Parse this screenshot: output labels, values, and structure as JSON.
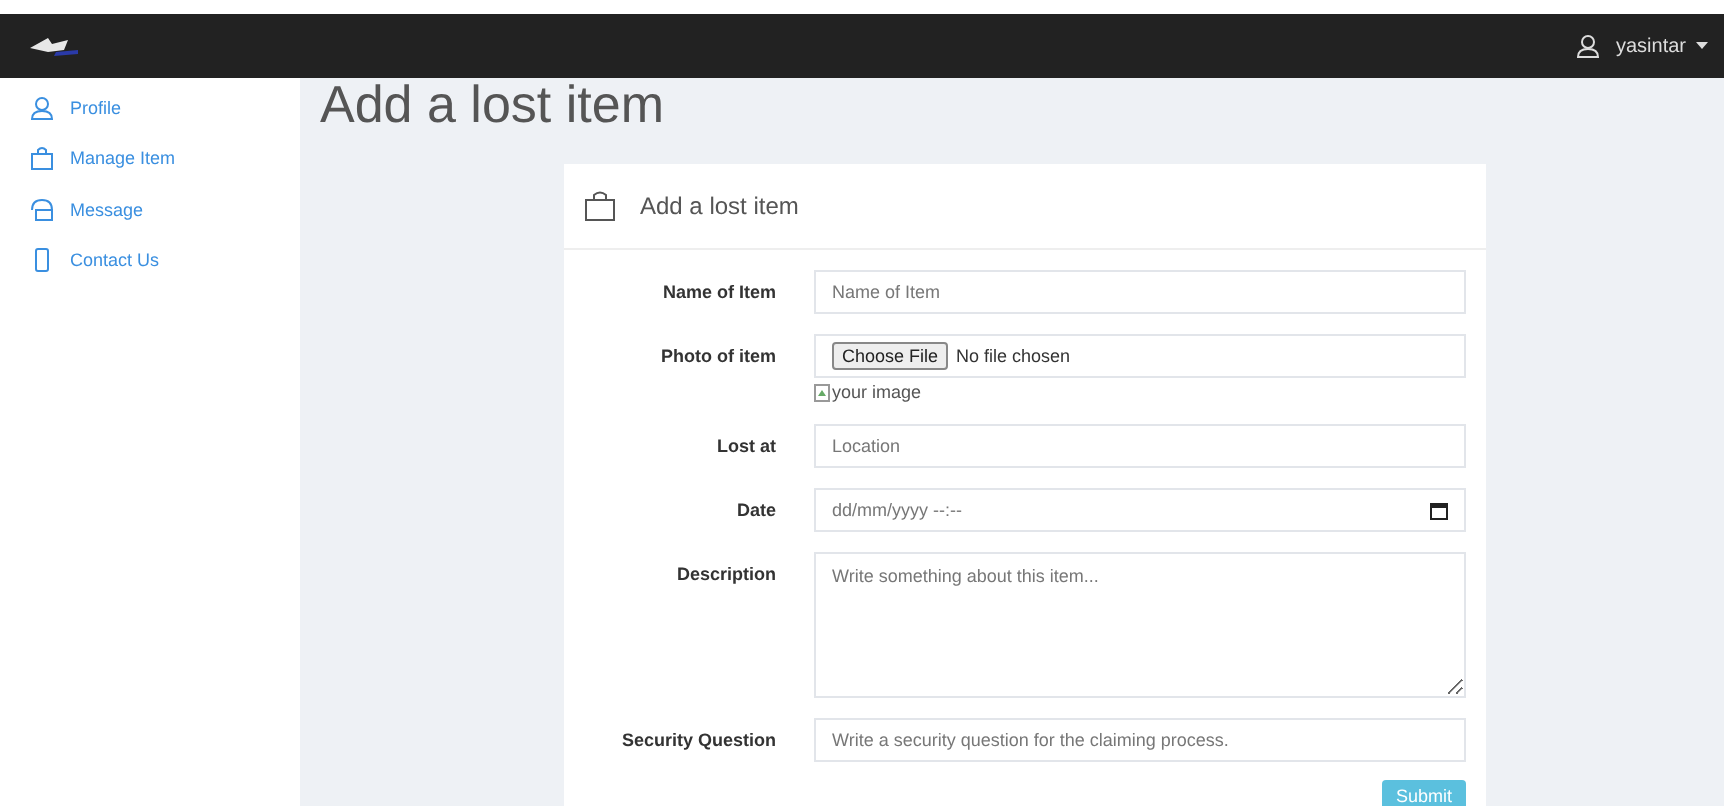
{
  "navbar": {
    "user": "yasintar"
  },
  "sidebar": {
    "items": [
      {
        "label": "Profile"
      },
      {
        "label": "Manage Item"
      },
      {
        "label": "Message"
      },
      {
        "label": "Contact Us"
      }
    ]
  },
  "page_title": "Add a lost item",
  "card": {
    "title": "Add a lost item",
    "fields": [
      {
        "kind": "text",
        "label": "Name of Item",
        "placeholder": "Name of Item"
      },
      {
        "kind": "file",
        "label": "Photo of item",
        "button": "Choose File",
        "status": "No file chosen",
        "image_alt": "your image"
      },
      {
        "kind": "text",
        "label": "Lost at",
        "placeholder": "Location"
      },
      {
        "kind": "date",
        "label": "Date",
        "placeholder": "dd/mm/yyyy --:--"
      },
      {
        "kind": "textarea",
        "label": "Description",
        "placeholder": "Write something about this item..."
      },
      {
        "kind": "text",
        "label": "Security Question",
        "placeholder": "Write a security question for the claiming process."
      }
    ],
    "submit": "Submit"
  }
}
